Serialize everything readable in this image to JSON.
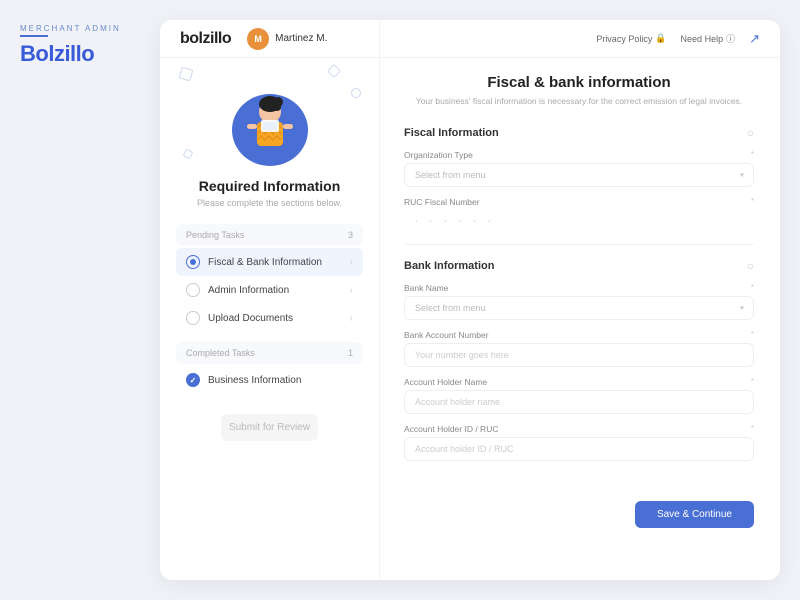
{
  "sidebar": {
    "merchant_label": "MERCHANT ADMIN",
    "brand": "Bolzillo"
  },
  "header": {
    "logo": "bolzillo",
    "user_name": "Martinez M.",
    "privacy_policy": "Privacy Policy",
    "need_help": "Need Help",
    "avatar_initials": "M"
  },
  "left_panel": {
    "illustration_alt": "Required Information Illustration",
    "title": "Required Information",
    "subtitle": "Please complete the sections below.",
    "pending_tasks": {
      "label": "Pending Tasks",
      "count": "3",
      "items": [
        {
          "id": "fiscal",
          "label": "Fiscal & Bank Information",
          "status": "active"
        },
        {
          "id": "admin",
          "label": "Admin Information",
          "status": "pending"
        },
        {
          "id": "upload",
          "label": "Upload Documents",
          "status": "pending"
        }
      ]
    },
    "completed_tasks": {
      "label": "Completed Tasks",
      "count": "1",
      "items": [
        {
          "id": "business",
          "label": "Business Information",
          "status": "completed"
        }
      ]
    },
    "submit_btn_label": "Submit for Review"
  },
  "right_panel": {
    "title": "Fiscal & bank information",
    "subtitle": "Your business' fiscal information is necessary for the correct emission of legal invoices.",
    "fiscal_section": {
      "heading": "Fiscal Information",
      "organization_type_label": "Organization Type",
      "organization_type_required": "*",
      "organization_select_placeholder": "Select from menu",
      "ruc_label": "RUC Fiscal Number",
      "ruc_required": "*"
    },
    "bank_section": {
      "heading": "Bank Information",
      "bank_name_label": "Bank Name",
      "bank_name_required": "*",
      "bank_select_placeholder": "Select from menu",
      "account_number_label": "Bank Account Number",
      "account_number_required": "*",
      "account_number_placeholder": "Your number goes here",
      "holder_name_label": "Account Holder Name",
      "holder_name_required": "*",
      "holder_name_placeholder": "Account holder name",
      "holder_id_label": "Account Holder ID / RUC",
      "holder_id_required": "*",
      "holder_id_placeholder": "Account holder ID / RUC"
    },
    "save_btn_label": "Save & Continue"
  }
}
